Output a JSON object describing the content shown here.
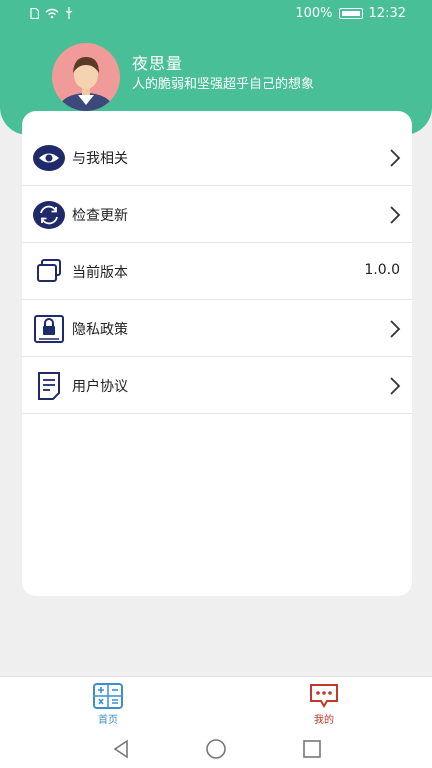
{
  "status_bar": {
    "battery_percent": "100%",
    "time": "12:32"
  },
  "profile": {
    "name": "夜思量",
    "signature": "人的脆弱和坚强超乎自己的想象"
  },
  "menu": [
    {
      "label": "与我相关",
      "icon": "eye-icon"
    },
    {
      "label": "检查更新",
      "icon": "refresh-icon"
    },
    {
      "label": "当前版本",
      "icon": "cards-icon",
      "value": "1.0.0"
    },
    {
      "label": "隐私政策",
      "icon": "lock-icon"
    },
    {
      "label": "用户协议",
      "icon": "document-icon"
    }
  ],
  "tabs": [
    {
      "label": "首页",
      "icon": "calculator-icon",
      "color": "#3a8fd0"
    },
    {
      "label": "我的",
      "icon": "chat-icon",
      "color": "#c0392b",
      "active": true
    }
  ],
  "colors": {
    "header": "#48bf97",
    "icon_navy": "#1f2a6b",
    "background": "#efefef"
  }
}
